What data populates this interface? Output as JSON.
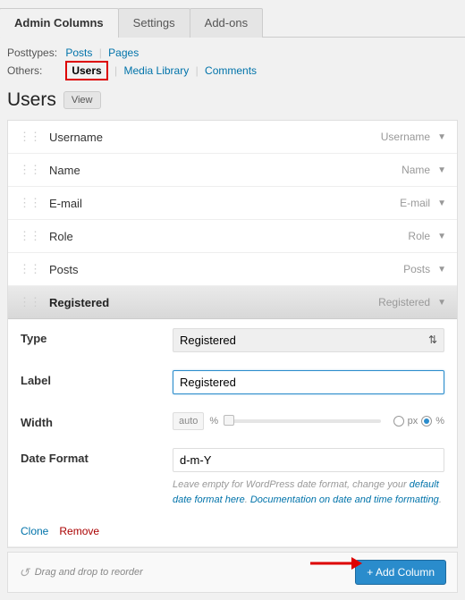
{
  "tabs": {
    "admin": "Admin Columns",
    "settings": "Settings",
    "addons": "Add-ons"
  },
  "filters": {
    "posttypes_label": "Posttypes:",
    "posts": "Posts",
    "pages": "Pages",
    "others_label": "Others:",
    "users": "Users",
    "media": "Media Library",
    "comments": "Comments"
  },
  "heading": {
    "title": "Users",
    "view": "View"
  },
  "columns": [
    {
      "label": "Username",
      "hint": "Username"
    },
    {
      "label": "Name",
      "hint": "Name"
    },
    {
      "label": "E-mail",
      "hint": "E-mail"
    },
    {
      "label": "Role",
      "hint": "Role"
    },
    {
      "label": "Posts",
      "hint": "Posts"
    }
  ],
  "active_col": {
    "label": "Registered",
    "hint": "Registered"
  },
  "panel": {
    "type_label": "Type",
    "type_value": "Registered",
    "label_label": "Label",
    "label_value": "Registered",
    "width_label": "Width",
    "width_auto": "auto",
    "width_pct": "%",
    "unit_px": "px",
    "unit_pct": "%",
    "dateformat_label": "Date Format",
    "dateformat_value": "d-m-Y",
    "hint_1": "Leave empty for WordPress date format, change your ",
    "hint_link1": "default date format here",
    "hint_2": ". ",
    "hint_link2": "Documentation on date and time formatting",
    "hint_3": ".",
    "clone": "Clone",
    "remove": "Remove"
  },
  "footer": {
    "reorder": "Drag and drop to reorder",
    "add": "+ Add Column"
  }
}
